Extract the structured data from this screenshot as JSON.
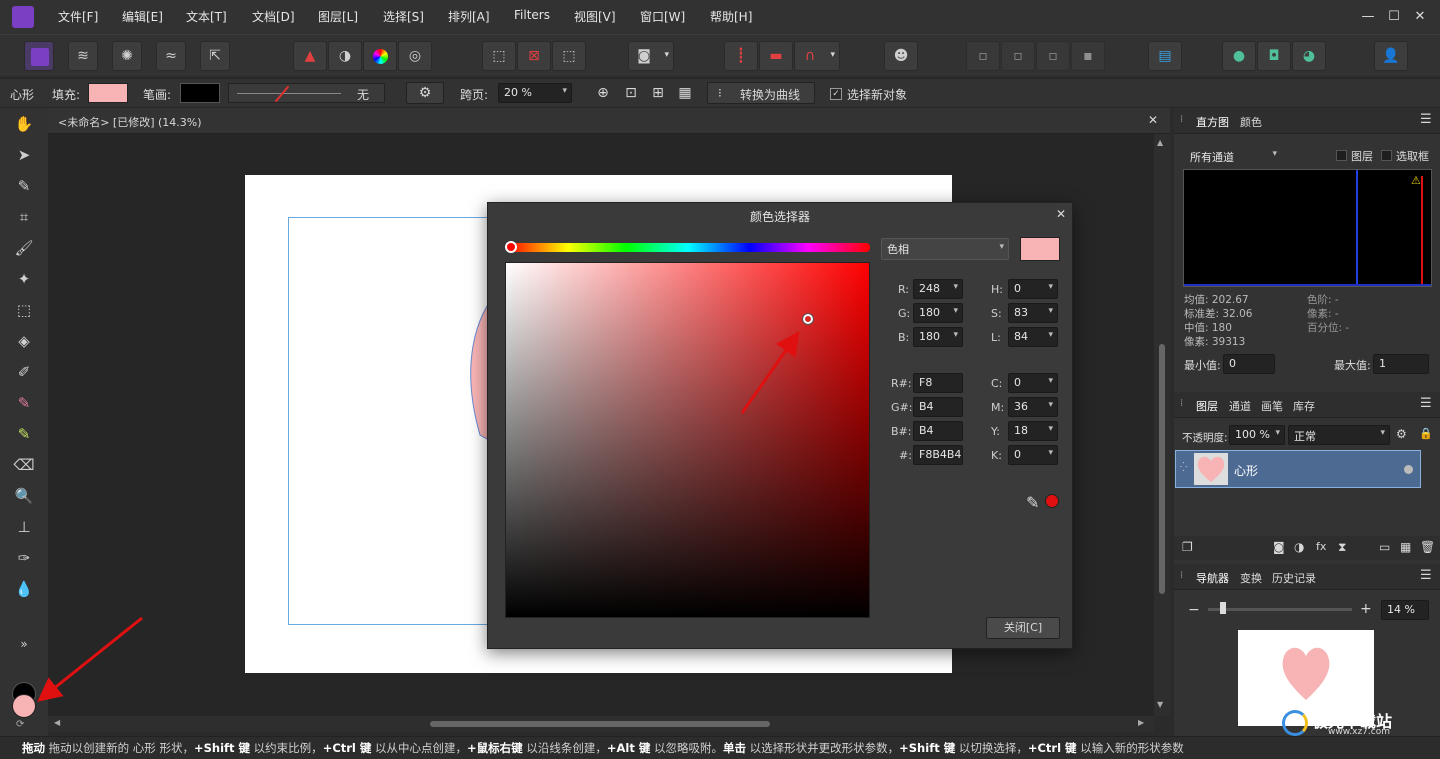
{
  "menubar": {
    "items": [
      "文件[F]",
      "编辑[E]",
      "文本[T]",
      "文档[D]",
      "图层[L]",
      "选择[S]",
      "排列[A]",
      "Filters",
      "视图[V]",
      "窗口[W]",
      "帮助[H]"
    ],
    "win_min": "—",
    "win_max": "☐",
    "win_close": "✕"
  },
  "context": {
    "shape": "心形",
    "fill_label": "填充:",
    "fill_color": "#F8B4B4",
    "stroke_label": "笔画:",
    "stroke_color": "#000000",
    "stroke_width_value": "无",
    "spread_label": "跨页:",
    "spread_value": "20 %",
    "convert_label": "转换为曲线",
    "select_new_label": "选择新对象"
  },
  "doc": {
    "tab_title": "<未命名> [已修改] (14.3%)",
    "close": "✕"
  },
  "dialog": {
    "title": "颜色选择器",
    "close": "✕",
    "mode_select": "色相",
    "swatch_color": "#F8B4B4",
    "rgb": [
      {
        "label": "R:",
        "value": "248"
      },
      {
        "label": "G:",
        "value": "180"
      },
      {
        "label": "B:",
        "value": "180"
      }
    ],
    "hsl": [
      {
        "label": "H:",
        "value": "0"
      },
      {
        "label": "S:",
        "value": "83"
      },
      {
        "label": "L:",
        "value": "84"
      }
    ],
    "hex_channels": [
      {
        "label": "R#:",
        "value": "F8"
      },
      {
        "label": "G#:",
        "value": "B4"
      },
      {
        "label": "B#:",
        "value": "B4"
      },
      {
        "label": "#:",
        "value": "F8B4B4"
      }
    ],
    "cmyk": [
      {
        "label": "C:",
        "value": "0"
      },
      {
        "label": "M:",
        "value": "36"
      },
      {
        "label": "Y:",
        "value": "18"
      },
      {
        "label": "K:",
        "value": "0"
      }
    ],
    "close_button": "关闭[C]"
  },
  "histogram": {
    "tabs": [
      "直方图",
      "颜色"
    ],
    "channel_select": "所有通道",
    "layer_check": "图层",
    "marquee_check": "选取框",
    "stats_left": [
      "均值: 202.67",
      "标准差: 32.06",
      "中值: 180",
      "像素: 39313"
    ],
    "stats_right": [
      "色阶: -",
      "像素: -",
      "百分位: -"
    ],
    "min_label": "最小值:",
    "min_value": "0",
    "max_label": "最大值:",
    "max_value": "1"
  },
  "layers": {
    "tabs": [
      "图层",
      "通道",
      "画笔",
      "库存"
    ],
    "opacity_label": "不透明度:",
    "opacity_value": "100 %",
    "blend_value": "正常",
    "layer_name": "心形"
  },
  "navigator": {
    "tabs": [
      "导航器",
      "变换",
      "历史记录"
    ],
    "zoom_value": "14 %",
    "zoom_minus": "−",
    "zoom_plus": "+"
  },
  "status": {
    "segments": [
      {
        "bold": "拖动",
        "text": " 拖动以创建新的 心形 形状，"
      },
      {
        "bold": "+Shift 键",
        "text": " 以约束比例，"
      },
      {
        "bold": "+Ctrl 键",
        "text": " 以从中心点创建，"
      },
      {
        "bold": "+鼠标右键",
        "text": " 以沿线条创建，"
      },
      {
        "bold": "+Alt 键",
        "text": " 以忽略吸附。"
      },
      {
        "bold": "单击",
        "text": " 以选择形状并更改形状参数，"
      },
      {
        "bold": "+Shift 键",
        "text": " 以切换选择，"
      },
      {
        "bold": "+Ctrl 键",
        "text": " 以输入新的形状参数"
      }
    ]
  },
  "watermark": {
    "name": "极光下载站",
    "url": "www.xz7.com"
  },
  "colors": {
    "accent_purple": "#7b3fc4",
    "shape_fill": "#F8B4B4",
    "arrow_red": "#e01010",
    "layer_selected": "#4d6a93"
  }
}
